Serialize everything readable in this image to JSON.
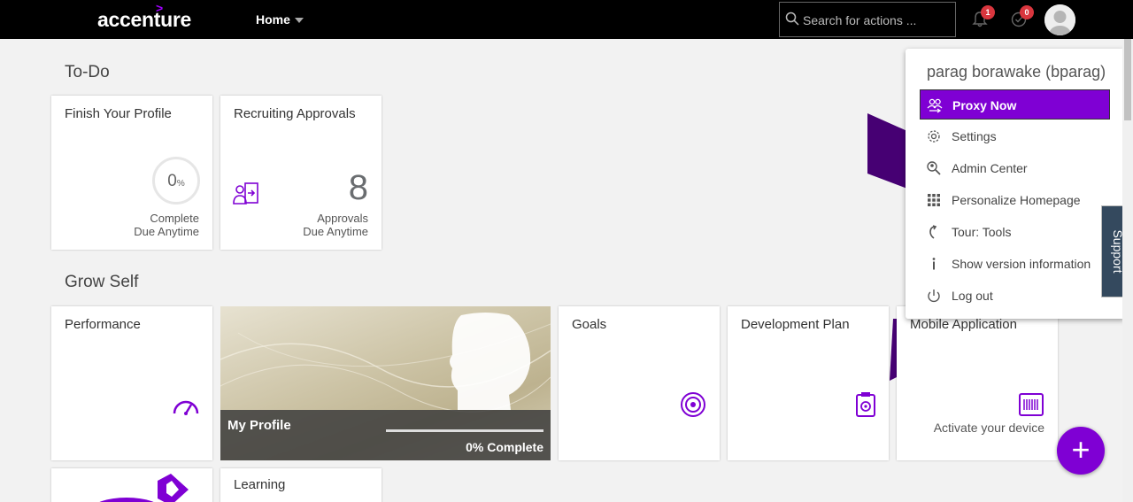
{
  "colors": {
    "accent": "#7f00d4",
    "topbar": "#000000",
    "badge": "#d9363e"
  },
  "header": {
    "logo": "accenture",
    "logo_mark": ">",
    "nav_home": "Home",
    "search_placeholder": "Search for actions ...",
    "notifications_count": "1",
    "todo_count": "0"
  },
  "todo": {
    "title": "To-Do",
    "tiles": [
      {
        "title": "Finish Your Profile",
        "ring_value": "0",
        "ring_unit": "%",
        "footer1": "Complete",
        "footer2": "Due Anytime"
      },
      {
        "title": "Recruiting Approvals",
        "count": "8",
        "footer1": "Approvals",
        "footer2": "Due Anytime"
      }
    ]
  },
  "grow": {
    "title": "Grow Self",
    "performance": "Performance",
    "profile": {
      "name": "My Profile",
      "progress_percent": 0,
      "status": "0% Complete"
    },
    "goals": "Goals",
    "development": "Development Plan",
    "mobile": {
      "title": "Mobile Application",
      "caption": "Activate your device"
    },
    "learning": "Learning"
  },
  "menu": {
    "user": "parag borawake (bparag)",
    "items": [
      {
        "label": "Proxy Now",
        "icon": "proxy-icon"
      },
      {
        "label": "Settings",
        "icon": "gear-icon"
      },
      {
        "label": "Admin Center",
        "icon": "admin-icon"
      },
      {
        "label": "Personalize Homepage",
        "icon": "grid-icon"
      },
      {
        "label": "Tour: Tools",
        "icon": "tour-icon"
      },
      {
        "label": "Show version information",
        "icon": "info-icon"
      },
      {
        "label": "Log out",
        "icon": "power-icon"
      }
    ]
  },
  "support_label": "Support",
  "fab_label": "+"
}
